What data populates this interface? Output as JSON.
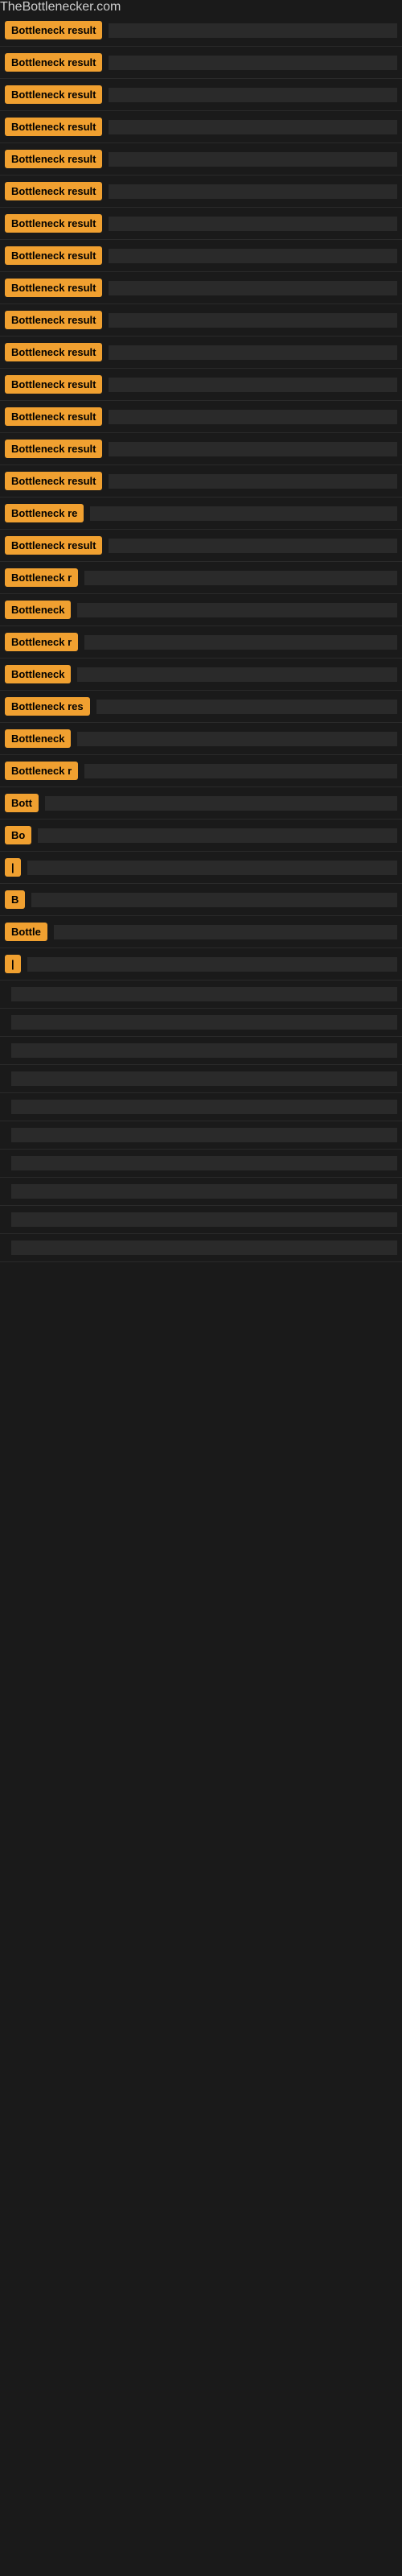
{
  "site": {
    "title": "TheBottlenecker.com"
  },
  "items": [
    {
      "label": "Bottleneck result",
      "barWidth": "85%"
    },
    {
      "label": "Bottleneck result",
      "barWidth": "82%"
    },
    {
      "label": "Bottleneck result",
      "barWidth": "80%"
    },
    {
      "label": "Bottleneck result",
      "barWidth": "78%"
    },
    {
      "label": "Bottleneck result",
      "barWidth": "75%"
    },
    {
      "label": "Bottleneck result",
      "barWidth": "73%"
    },
    {
      "label": "Bottleneck result",
      "barWidth": "70%"
    },
    {
      "label": "Bottleneck result",
      "barWidth": "68%"
    },
    {
      "label": "Bottleneck result",
      "barWidth": "65%"
    },
    {
      "label": "Bottleneck result",
      "barWidth": "63%"
    },
    {
      "label": "Bottleneck result",
      "barWidth": "60%"
    },
    {
      "label": "Bottleneck result",
      "barWidth": "58%"
    },
    {
      "label": "Bottleneck result",
      "barWidth": "55%"
    },
    {
      "label": "Bottleneck result",
      "barWidth": "53%"
    },
    {
      "label": "Bottleneck result",
      "barWidth": "50%"
    },
    {
      "label": "Bottleneck re",
      "barWidth": "48%"
    },
    {
      "label": "Bottleneck result",
      "barWidth": "46%"
    },
    {
      "label": "Bottleneck r",
      "barWidth": "44%"
    },
    {
      "label": "Bottleneck",
      "barWidth": "42%"
    },
    {
      "label": "Bottleneck r",
      "barWidth": "40%"
    },
    {
      "label": "Bottleneck",
      "barWidth": "38%"
    },
    {
      "label": "Bottleneck res",
      "barWidth": "36%"
    },
    {
      "label": "Bottleneck",
      "barWidth": "34%"
    },
    {
      "label": "Bottleneck r",
      "barWidth": "32%"
    },
    {
      "label": "Bott",
      "barWidth": "28%"
    },
    {
      "label": "Bo",
      "barWidth": "24%"
    },
    {
      "label": "|",
      "barWidth": "20%"
    },
    {
      "label": "B",
      "barWidth": "16%"
    },
    {
      "label": "Bottle",
      "barWidth": "14%"
    },
    {
      "label": "|",
      "barWidth": "10%"
    },
    {
      "label": "",
      "barWidth": "8%"
    },
    {
      "label": "",
      "barWidth": "6%"
    },
    {
      "label": "",
      "barWidth": "5%"
    },
    {
      "label": "",
      "barWidth": "4%"
    },
    {
      "label": "",
      "barWidth": "3%"
    },
    {
      "label": "",
      "barWidth": "2%"
    },
    {
      "label": "",
      "barWidth": "2%"
    },
    {
      "label": "",
      "barWidth": "1%"
    },
    {
      "label": "",
      "barWidth": "1%"
    },
    {
      "label": "",
      "barWidth": "1%"
    }
  ]
}
